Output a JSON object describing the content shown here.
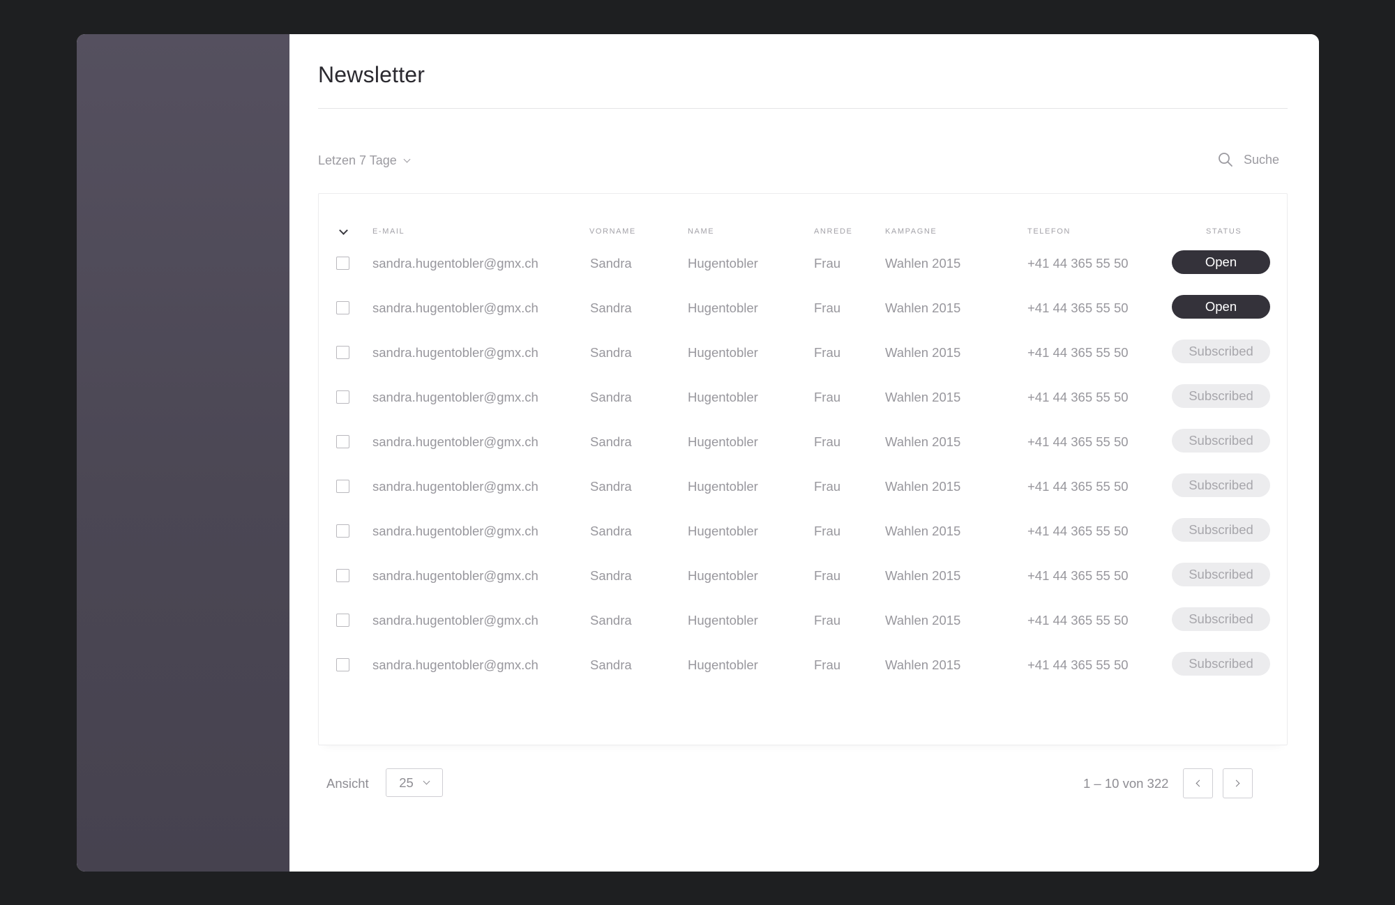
{
  "page": {
    "title": "Newsletter"
  },
  "filter": {
    "label": "Letzen 7 Tage"
  },
  "search": {
    "label": "Suche"
  },
  "table": {
    "columns": {
      "email": "E-MAIL",
      "vorname": "VORNAME",
      "name": "NAME",
      "anrede": "ANREDE",
      "kampagne": "KAMPAGNE",
      "telefon": "TELEFON",
      "status": "STATUS"
    },
    "rows": [
      {
        "email": "sandra.hugentobler@gmx.ch",
        "vorname": "Sandra",
        "name": "Hugentobler",
        "anrede": "Frau",
        "kampagne": "Wahlen 2015",
        "telefon": "+41 44 365 55 50",
        "status": "Open",
        "status_type": "open"
      },
      {
        "email": "sandra.hugentobler@gmx.ch",
        "vorname": "Sandra",
        "name": "Hugentobler",
        "anrede": "Frau",
        "kampagne": "Wahlen 2015",
        "telefon": "+41 44 365 55 50",
        "status": "Open",
        "status_type": "open"
      },
      {
        "email": "sandra.hugentobler@gmx.ch",
        "vorname": "Sandra",
        "name": "Hugentobler",
        "anrede": "Frau",
        "kampagne": "Wahlen 2015",
        "telefon": "+41 44 365 55 50",
        "status": "Subscribed",
        "status_type": "subscribed"
      },
      {
        "email": "sandra.hugentobler@gmx.ch",
        "vorname": "Sandra",
        "name": "Hugentobler",
        "anrede": "Frau",
        "kampagne": "Wahlen 2015",
        "telefon": "+41 44 365 55 50",
        "status": "Subscribed",
        "status_type": "subscribed"
      },
      {
        "email": "sandra.hugentobler@gmx.ch",
        "vorname": "Sandra",
        "name": "Hugentobler",
        "anrede": "Frau",
        "kampagne": "Wahlen 2015",
        "telefon": "+41 44 365 55 50",
        "status": "Subscribed",
        "status_type": "subscribed"
      },
      {
        "email": "sandra.hugentobler@gmx.ch",
        "vorname": "Sandra",
        "name": "Hugentobler",
        "anrede": "Frau",
        "kampagne": "Wahlen 2015",
        "telefon": "+41 44 365 55 50",
        "status": "Subscribed",
        "status_type": "subscribed"
      },
      {
        "email": "sandra.hugentobler@gmx.ch",
        "vorname": "Sandra",
        "name": "Hugentobler",
        "anrede": "Frau",
        "kampagne": "Wahlen 2015",
        "telefon": "+41 44 365 55 50",
        "status": "Subscribed",
        "status_type": "subscribed"
      },
      {
        "email": "sandra.hugentobler@gmx.ch",
        "vorname": "Sandra",
        "name": "Hugentobler",
        "anrede": "Frau",
        "kampagne": "Wahlen 2015",
        "telefon": "+41 44 365 55 50",
        "status": "Subscribed",
        "status_type": "subscribed"
      },
      {
        "email": "sandra.hugentobler@gmx.ch",
        "vorname": "Sandra",
        "name": "Hugentobler",
        "anrede": "Frau",
        "kampagne": "Wahlen 2015",
        "telefon": "+41 44 365 55 50",
        "status": "Subscribed",
        "status_type": "subscribed"
      },
      {
        "email": "sandra.hugentobler@gmx.ch",
        "vorname": "Sandra",
        "name": "Hugentobler",
        "anrede": "Frau",
        "kampagne": "Wahlen 2015",
        "telefon": "+41 44 365 55 50",
        "status": "Subscribed",
        "status_type": "subscribed"
      }
    ]
  },
  "pagination": {
    "view_label": "Ansicht",
    "page_size": "25",
    "range": "1 – 10 von 322"
  },
  "icons": {
    "search": "search-icon",
    "filter_chevron": "chevron-down-icon",
    "select_all": "chevron-down-icon",
    "page_size_chevron": "chevron-down-icon",
    "prev": "chevron-left-icon",
    "next": "chevron-right-icon"
  },
  "colors": {
    "background": "#1e1f21",
    "sidebar": "#4b4754",
    "status_open_bg": "#34323a",
    "status_subscribed_bg": "#ececee"
  }
}
